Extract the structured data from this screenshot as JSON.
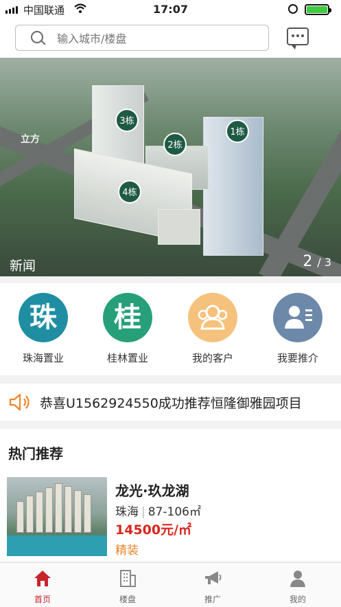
{
  "status_bar": {
    "carrier": "中国联通",
    "time": "17:07"
  },
  "search": {
    "placeholder": "输入城市/楼盘"
  },
  "banner": {
    "logo_text": "立方",
    "buildings": [
      "1栋",
      "2栋",
      "3栋",
      "4栋"
    ],
    "title": "新闻",
    "page_current": "2",
    "page_total": "/ 3"
  },
  "shortcuts": [
    {
      "label": "珠海置业",
      "glyph": "珠",
      "color": "#1f8ea3",
      "icon": "zhu-badge-icon"
    },
    {
      "label": "桂林置业",
      "glyph": "桂",
      "color": "#27a07a",
      "icon": "gui-badge-icon"
    },
    {
      "label": "我的客户",
      "glyph": "",
      "color": "#f5c27d",
      "icon": "customers-icon"
    },
    {
      "label": "我要推介",
      "glyph": "",
      "color": "#6d89aa",
      "icon": "recommend-icon"
    }
  ],
  "notice": {
    "text": "恭喜U1562924550成功推荐恒隆御雅园项目",
    "icon": "speaker-icon",
    "icon_color": "#e8862a"
  },
  "hot": {
    "title": "热门推荐",
    "items": [
      {
        "name": "龙光·玖龙湖",
        "city": "珠海",
        "area": "87-106㎡",
        "price": "14500元/㎡",
        "tag": "精装"
      }
    ]
  },
  "tabbar": {
    "accent": "#c8232c",
    "tabs": [
      {
        "label": "首页",
        "icon": "home-icon",
        "active": true
      },
      {
        "label": "楼盘",
        "icon": "building-icon",
        "active": false
      },
      {
        "label": "推广",
        "icon": "megaphone-icon",
        "active": false
      },
      {
        "label": "我的",
        "icon": "profile-icon",
        "active": false
      }
    ]
  }
}
